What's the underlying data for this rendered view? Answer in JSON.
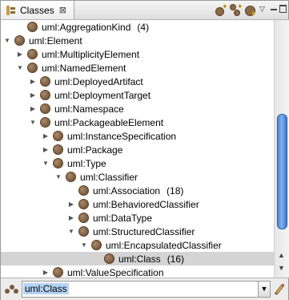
{
  "view": {
    "tab_title": "Classes",
    "tab_close": "⊠"
  },
  "toolbar": {
    "view_menu_arrow": "▽",
    "scroll_up": "▲",
    "scroll_down": "▼"
  },
  "tree": {
    "rows": [
      {
        "label": "uml:AggregationKind",
        "count": "(4)",
        "indent": 2,
        "twisty": "",
        "selected": false
      },
      {
        "label": "uml:Element",
        "count": "",
        "indent": 1,
        "twisty": "▼",
        "selected": false
      },
      {
        "label": "uml:MultiplicityElement",
        "count": "",
        "indent": 2,
        "twisty": "▶",
        "selected": false
      },
      {
        "label": "uml:NamedElement",
        "count": "",
        "indent": 2,
        "twisty": "▼",
        "selected": false
      },
      {
        "label": "uml:DeployedArtifact",
        "count": "",
        "indent": 3,
        "twisty": "▶",
        "selected": false
      },
      {
        "label": "uml:DeploymentTarget",
        "count": "",
        "indent": 3,
        "twisty": "▶",
        "selected": false
      },
      {
        "label": "uml:Namespace",
        "count": "",
        "indent": 3,
        "twisty": "▶",
        "selected": false
      },
      {
        "label": "uml:PackageableElement",
        "count": "",
        "indent": 3,
        "twisty": "▼",
        "selected": false
      },
      {
        "label": "uml:InstanceSpecification",
        "count": "",
        "indent": 4,
        "twisty": "▶",
        "selected": false
      },
      {
        "label": "uml:Package",
        "count": "",
        "indent": 4,
        "twisty": "▶",
        "selected": false
      },
      {
        "label": "uml:Type",
        "count": "",
        "indent": 4,
        "twisty": "▼",
        "selected": false
      },
      {
        "label": "uml:Classifier",
        "count": "",
        "indent": 5,
        "twisty": "▼",
        "selected": false
      },
      {
        "label": "uml:Association",
        "count": "(18)",
        "indent": 6,
        "twisty": "",
        "selected": false
      },
      {
        "label": "uml:BehavioredClassifier",
        "count": "",
        "indent": 6,
        "twisty": "▶",
        "selected": false
      },
      {
        "label": "uml:DataType",
        "count": "",
        "indent": 6,
        "twisty": "▶",
        "selected": false
      },
      {
        "label": "uml:StructuredClassifier",
        "count": "",
        "indent": 6,
        "twisty": "▼",
        "selected": false
      },
      {
        "label": "uml:EncapsulatedClassifier",
        "count": "",
        "indent": 7,
        "twisty": "▼",
        "selected": false
      },
      {
        "label": "uml:Class",
        "count": "(16)",
        "indent": 8,
        "twisty": "",
        "selected": true
      },
      {
        "label": "uml:ValueSpecification",
        "count": "",
        "indent": 4,
        "twisty": "▶",
        "selected": false
      }
    ]
  },
  "filter": {
    "value": "uml:Class",
    "dropdown_arrow": "▼"
  },
  "colors": {
    "node_icon": "#7a5b3e",
    "selection": "#d4d4d4",
    "scroll_thumb": "#4f86d3",
    "filter_highlight": "#b5d3f5"
  }
}
